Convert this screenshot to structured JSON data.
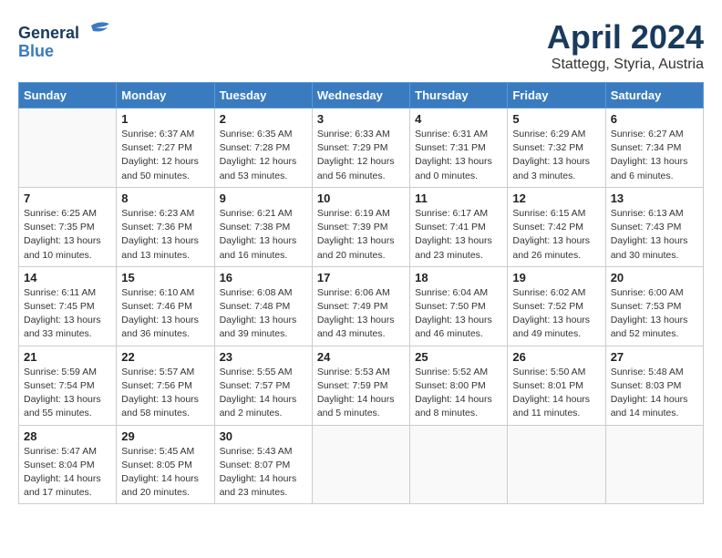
{
  "logo": {
    "line1": "General",
    "line2": "Blue"
  },
  "title": "April 2024",
  "subtitle": "Stattegg, Styria, Austria",
  "headers": [
    "Sunday",
    "Monday",
    "Tuesday",
    "Wednesday",
    "Thursday",
    "Friday",
    "Saturday"
  ],
  "weeks": [
    [
      {
        "day": "",
        "info": ""
      },
      {
        "day": "1",
        "info": "Sunrise: 6:37 AM\nSunset: 7:27 PM\nDaylight: 12 hours\nand 50 minutes."
      },
      {
        "day": "2",
        "info": "Sunrise: 6:35 AM\nSunset: 7:28 PM\nDaylight: 12 hours\nand 53 minutes."
      },
      {
        "day": "3",
        "info": "Sunrise: 6:33 AM\nSunset: 7:29 PM\nDaylight: 12 hours\nand 56 minutes."
      },
      {
        "day": "4",
        "info": "Sunrise: 6:31 AM\nSunset: 7:31 PM\nDaylight: 13 hours\nand 0 minutes."
      },
      {
        "day": "5",
        "info": "Sunrise: 6:29 AM\nSunset: 7:32 PM\nDaylight: 13 hours\nand 3 minutes."
      },
      {
        "day": "6",
        "info": "Sunrise: 6:27 AM\nSunset: 7:34 PM\nDaylight: 13 hours\nand 6 minutes."
      }
    ],
    [
      {
        "day": "7",
        "info": "Sunrise: 6:25 AM\nSunset: 7:35 PM\nDaylight: 13 hours\nand 10 minutes."
      },
      {
        "day": "8",
        "info": "Sunrise: 6:23 AM\nSunset: 7:36 PM\nDaylight: 13 hours\nand 13 minutes."
      },
      {
        "day": "9",
        "info": "Sunrise: 6:21 AM\nSunset: 7:38 PM\nDaylight: 13 hours\nand 16 minutes."
      },
      {
        "day": "10",
        "info": "Sunrise: 6:19 AM\nSunset: 7:39 PM\nDaylight: 13 hours\nand 20 minutes."
      },
      {
        "day": "11",
        "info": "Sunrise: 6:17 AM\nSunset: 7:41 PM\nDaylight: 13 hours\nand 23 minutes."
      },
      {
        "day": "12",
        "info": "Sunrise: 6:15 AM\nSunset: 7:42 PM\nDaylight: 13 hours\nand 26 minutes."
      },
      {
        "day": "13",
        "info": "Sunrise: 6:13 AM\nSunset: 7:43 PM\nDaylight: 13 hours\nand 30 minutes."
      }
    ],
    [
      {
        "day": "14",
        "info": "Sunrise: 6:11 AM\nSunset: 7:45 PM\nDaylight: 13 hours\nand 33 minutes."
      },
      {
        "day": "15",
        "info": "Sunrise: 6:10 AM\nSunset: 7:46 PM\nDaylight: 13 hours\nand 36 minutes."
      },
      {
        "day": "16",
        "info": "Sunrise: 6:08 AM\nSunset: 7:48 PM\nDaylight: 13 hours\nand 39 minutes."
      },
      {
        "day": "17",
        "info": "Sunrise: 6:06 AM\nSunset: 7:49 PM\nDaylight: 13 hours\nand 43 minutes."
      },
      {
        "day": "18",
        "info": "Sunrise: 6:04 AM\nSunset: 7:50 PM\nDaylight: 13 hours\nand 46 minutes."
      },
      {
        "day": "19",
        "info": "Sunrise: 6:02 AM\nSunset: 7:52 PM\nDaylight: 13 hours\nand 49 minutes."
      },
      {
        "day": "20",
        "info": "Sunrise: 6:00 AM\nSunset: 7:53 PM\nDaylight: 13 hours\nand 52 minutes."
      }
    ],
    [
      {
        "day": "21",
        "info": "Sunrise: 5:59 AM\nSunset: 7:54 PM\nDaylight: 13 hours\nand 55 minutes."
      },
      {
        "day": "22",
        "info": "Sunrise: 5:57 AM\nSunset: 7:56 PM\nDaylight: 13 hours\nand 58 minutes."
      },
      {
        "day": "23",
        "info": "Sunrise: 5:55 AM\nSunset: 7:57 PM\nDaylight: 14 hours\nand 2 minutes."
      },
      {
        "day": "24",
        "info": "Sunrise: 5:53 AM\nSunset: 7:59 PM\nDaylight: 14 hours\nand 5 minutes."
      },
      {
        "day": "25",
        "info": "Sunrise: 5:52 AM\nSunset: 8:00 PM\nDaylight: 14 hours\nand 8 minutes."
      },
      {
        "day": "26",
        "info": "Sunrise: 5:50 AM\nSunset: 8:01 PM\nDaylight: 14 hours\nand 11 minutes."
      },
      {
        "day": "27",
        "info": "Sunrise: 5:48 AM\nSunset: 8:03 PM\nDaylight: 14 hours\nand 14 minutes."
      }
    ],
    [
      {
        "day": "28",
        "info": "Sunrise: 5:47 AM\nSunset: 8:04 PM\nDaylight: 14 hours\nand 17 minutes."
      },
      {
        "day": "29",
        "info": "Sunrise: 5:45 AM\nSunset: 8:05 PM\nDaylight: 14 hours\nand 20 minutes."
      },
      {
        "day": "30",
        "info": "Sunrise: 5:43 AM\nSunset: 8:07 PM\nDaylight: 14 hours\nand 23 minutes."
      },
      {
        "day": "",
        "info": ""
      },
      {
        "day": "",
        "info": ""
      },
      {
        "day": "",
        "info": ""
      },
      {
        "day": "",
        "info": ""
      }
    ]
  ]
}
